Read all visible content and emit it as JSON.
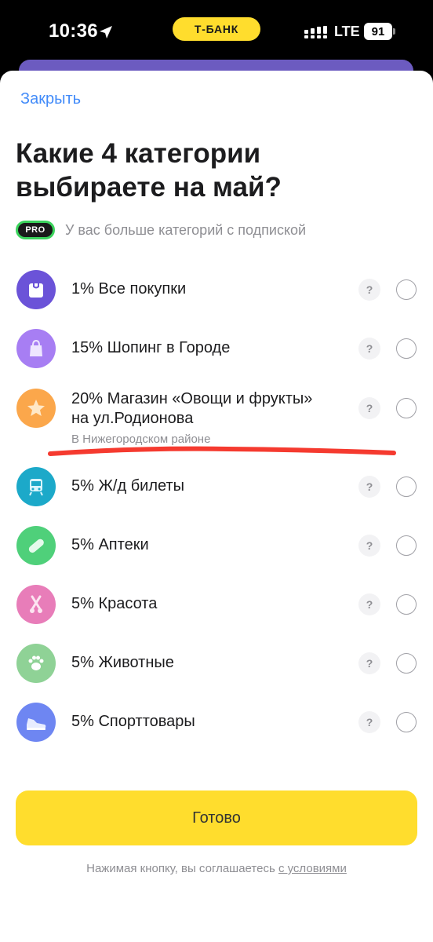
{
  "status_bar": {
    "time": "10:36",
    "bank_name": "Т-БАНК",
    "network": "LTE",
    "battery": "91"
  },
  "header": {
    "close_label": "Закрыть",
    "title": "Какие 4 категории выбираете на май?"
  },
  "pro": {
    "badge": "PRO",
    "text": "У вас больше категорий с подпиской"
  },
  "categories": [
    {
      "label": "1% Все покупки",
      "icon": "shopping-bag-icon",
      "color": "#6B53D8"
    },
    {
      "label": "15% Шопинг в Городе",
      "icon": "shopping-bag-icon",
      "color": "#A77EF3"
    },
    {
      "label_line1": "20% Магазин «Овощи и фрукты»",
      "label_line2": "на ул.Родионова",
      "sub": "В Нижегородском районе",
      "icon": "star-icon",
      "color": "#FBA74B"
    },
    {
      "label": "5% Ж/д билеты",
      "icon": "train-icon",
      "color": "#1CA9C9"
    },
    {
      "label": "5% Аптеки",
      "icon": "pill-icon",
      "color": "#4FD07A"
    },
    {
      "label": "5% Красота",
      "icon": "scissors-icon",
      "color": "#E87DB9"
    },
    {
      "label": "5% Животные",
      "icon": "paw-icon",
      "color": "#8FD296"
    },
    {
      "label": "5% Спорттовары",
      "icon": "sneaker-icon",
      "color": "#6E86F2"
    }
  ],
  "help_symbol": "?",
  "done_button": "Готово",
  "terms": {
    "text": "Нажимая кнопку, вы соглашаетесь ",
    "link": "с условиями"
  },
  "colors": {
    "accent_yellow": "#FFDD2D",
    "link_blue": "#428BF9",
    "pro_green": "#3BD35C",
    "annotation_red": "#F53A2F"
  }
}
